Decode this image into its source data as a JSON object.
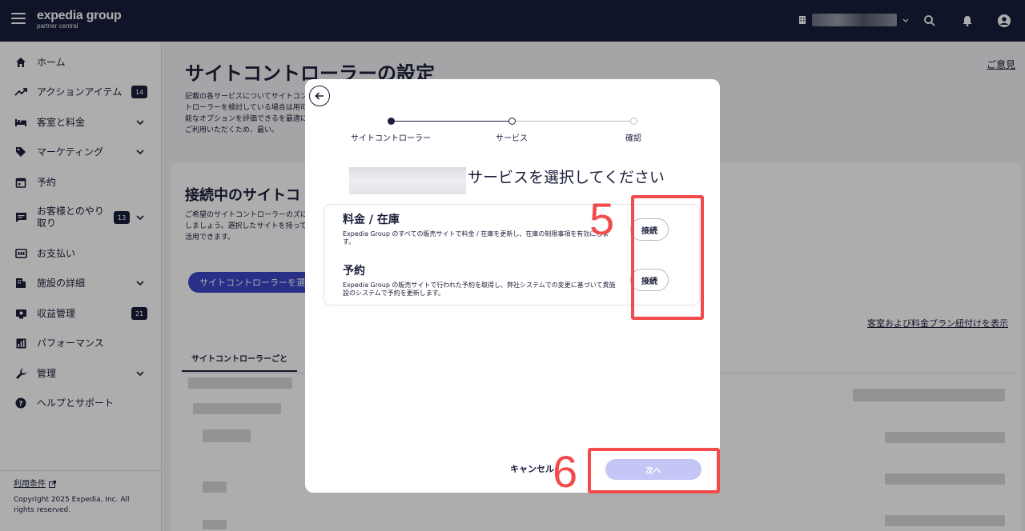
{
  "topbar": {
    "brand_name": "expedia group",
    "brand_sub": "partner central",
    "icons": [
      "menu-icon",
      "building-icon",
      "chevron-down-icon",
      "search-icon",
      "bell-icon",
      "account-icon"
    ]
  },
  "sidebar": {
    "items": [
      {
        "label": "ホーム",
        "icon": "home-icon"
      },
      {
        "label": "アクションアイテム",
        "icon": "trend-icon",
        "badge": "14"
      },
      {
        "label": "客室と料金",
        "icon": "bed-icon"
      },
      {
        "label": "マーケティング",
        "icon": "tag-icon"
      },
      {
        "label": "予約",
        "icon": "calendar-icon"
      },
      {
        "label": "お客様とのやり取り",
        "icon": "chat-icon",
        "badge": "13"
      },
      {
        "label": "お支払い",
        "icon": "payment-icon"
      },
      {
        "label": "施設の詳細",
        "icon": "property-icon"
      },
      {
        "label": "収益管理",
        "icon": "revenue-icon",
        "badge": "21"
      },
      {
        "label": "パフォーマンス",
        "icon": "chart-icon"
      },
      {
        "label": "管理",
        "icon": "wrench-icon"
      },
      {
        "label": "ヘルプとサポート",
        "icon": "help-icon"
      }
    ],
    "terms": "利用条件",
    "copyright": "Copyright 2025 Expedia, Inc. All rights reserved."
  },
  "main": {
    "title": "サイトコントローラーの設定",
    "feedback": "ご意見",
    "intro": "記載の各サービスについてサイトコントローラーを検討している場合は用可能なオプションを評価できるを最適にご利用いただくため、最い。",
    "card_title": "接続中のサイトコ",
    "card_desc": "ご希望のサイトコントローラーのズにしましょう。選択したサイトを持って活用できます。",
    "select_button": "サイトコントローラーを選",
    "room_link": "客室および料金プラン紐付けを表示",
    "tab_label": "サイトコントローラーごと"
  },
  "modal": {
    "steps": [
      "サイトコントローラー",
      "サービス",
      "確認"
    ],
    "title": "サービスを選択してください",
    "services": [
      {
        "title": "料金 / 在庫",
        "desc": "Expedia Group のすべての販売サイトで料金 / 在庫を更新し、在庫の制限事項を有効にします。",
        "button": "接続"
      },
      {
        "title": "予約",
        "desc": "Expedia Group の販売サイトで行われた予約を取得し、弊社システムでの変更に基づいて貴施設のシステムで予約を更新します。",
        "button": "接続"
      }
    ],
    "cancel": "キャンセル",
    "next": "次へ"
  },
  "annotations": {
    "num5": "5",
    "num6": "6",
    "color": "#f24b4b"
  }
}
